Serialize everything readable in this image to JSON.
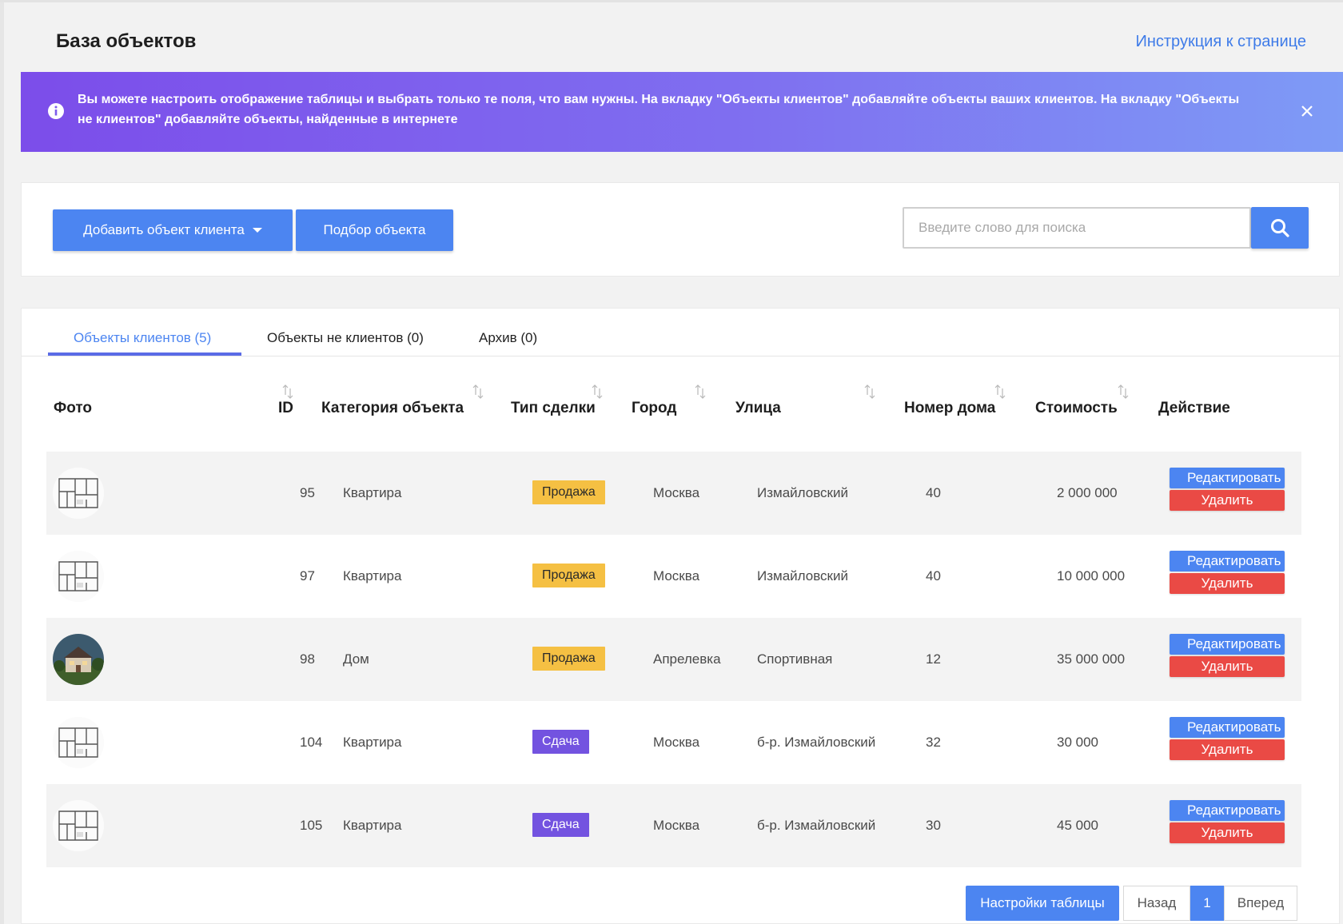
{
  "header": {
    "title": "База объектов",
    "help_link": "Инструкция к странице"
  },
  "banner": {
    "icon": "info-icon",
    "message": "Вы можете настроить отображение таблицы и выбрать только те поля, что вам нужны. На вкладку \"Объекты клиентов\" добавляйте объекты ваших клиентов. На вкладку \"Объекты не клиентов\" добавляйте объекты, найденные в интернете",
    "close_icon": "close-icon"
  },
  "toolbar": {
    "add_label": "Добавить объект клиента",
    "pick_label": "Подбор объекта",
    "search_placeholder": "Введите слово для поиска"
  },
  "tabs": [
    {
      "label": "Объекты клиентов (5)",
      "active": true
    },
    {
      "label": "Объекты не клиентов (0)",
      "active": false
    },
    {
      "label": "Архив (0)",
      "active": false
    }
  ],
  "columns": [
    "Фото",
    "ID",
    "Категория объекта",
    "Тип сделки",
    "Город",
    "Улица",
    "Номер дома",
    "Стоимость",
    "Действие"
  ],
  "rows": [
    {
      "photo": "floorplan",
      "id": "95",
      "category": "Квартира",
      "deal": "Продажа",
      "deal_type": "sale",
      "city": "Москва",
      "street": "Измайловский",
      "house": "40",
      "price": "2 000 000"
    },
    {
      "photo": "floorplan",
      "id": "97",
      "category": "Квартира",
      "deal": "Продажа",
      "deal_type": "sale",
      "city": "Москва",
      "street": "Измайловский",
      "house": "40",
      "price": "10 000 000"
    },
    {
      "photo": "house",
      "id": "98",
      "category": "Дом",
      "deal": "Продажа",
      "deal_type": "sale",
      "city": "Апрелевка",
      "street": "Спортивная",
      "house": "12",
      "price": "35 000 000"
    },
    {
      "photo": "floorplan",
      "id": "104",
      "category": "Квартира",
      "deal": "Сдача",
      "deal_type": "rent",
      "city": "Москва",
      "street": "б-р. Измайловский",
      "house": "32",
      "price": "30 000"
    },
    {
      "photo": "floorplan",
      "id": "105",
      "category": "Квартира",
      "deal": "Сдача",
      "deal_type": "rent",
      "city": "Москва",
      "street": "б-р. Измайловский",
      "house": "30",
      "price": "45 000"
    }
  ],
  "actions": {
    "edit": "Редактировать",
    "delete": "Удалить"
  },
  "pagination": {
    "settings": "Настройки таблицы",
    "prev": "Назад",
    "current": "1",
    "next": "Вперед"
  },
  "colors": {
    "primary": "#4c85f1",
    "danger": "#ea4a45",
    "sale_badge": "#f5c043",
    "rent_badge": "#7353e0"
  }
}
